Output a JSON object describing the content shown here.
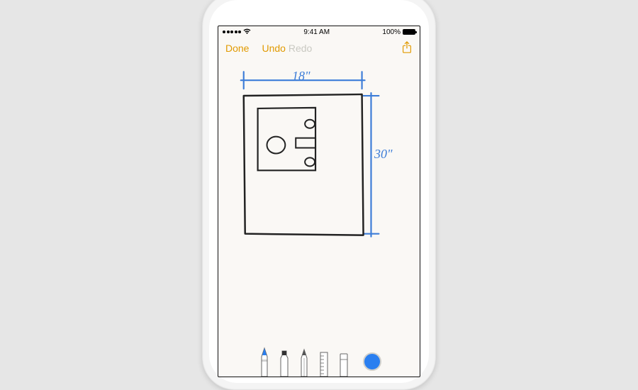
{
  "status": {
    "carrier_dots": 5,
    "wifi": "wifi",
    "time": "9:41 AM",
    "battery_pct": "100%"
  },
  "nav": {
    "done": "Done",
    "undo": "Undo",
    "redo": "Redo"
  },
  "sketch": {
    "width_label": "18\"",
    "height_label": "30\""
  },
  "tools": {
    "pen": "pen",
    "marker": "marker",
    "pencil": "pencil",
    "ruler": "ruler",
    "eraser": "eraser",
    "selected_color": "#2a7ff0"
  }
}
